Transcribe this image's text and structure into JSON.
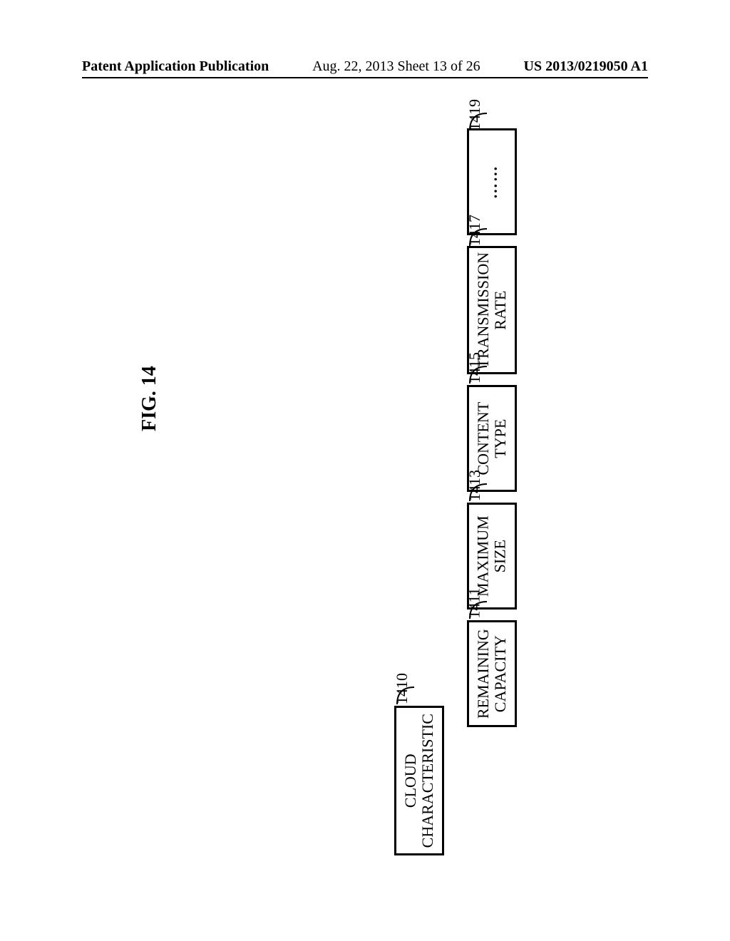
{
  "header": {
    "publication": "Patent Application Publication",
    "sheet": "Aug. 22, 2013  Sheet 13 of 26",
    "docnum": "US 2013/0219050 A1"
  },
  "figure_title": "FIG. 14",
  "blocks": {
    "cloud": {
      "ref": "1410",
      "line1": "CLOUD",
      "line2": "CHARACTERISTIC"
    },
    "remaining": {
      "ref": "1411",
      "line1": "REMAINING",
      "line2": "CAPACITY"
    },
    "maxsize": {
      "ref": "1413",
      "line1": "MAXIMUM",
      "line2": "SIZE"
    },
    "content": {
      "ref": "1415",
      "line1": "CONTENT",
      "line2": "TYPE"
    },
    "trans": {
      "ref": "1417",
      "line1": "TRANSMISSION",
      "line2": "RATE"
    },
    "more": {
      "ref": "1419",
      "text": "……"
    }
  }
}
